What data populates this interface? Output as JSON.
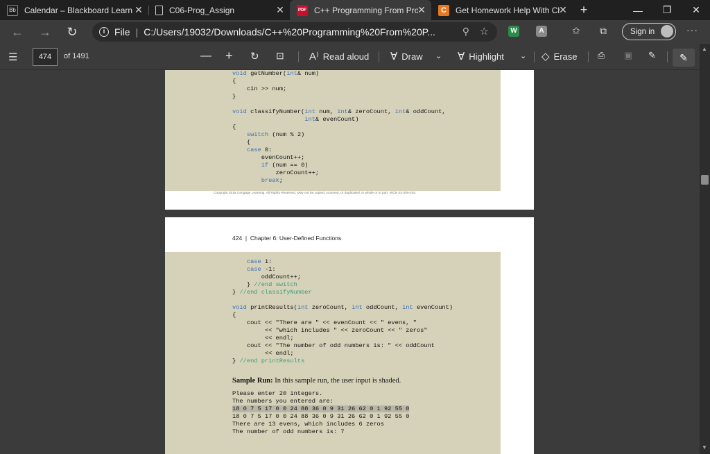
{
  "browser": {
    "tabs": [
      {
        "title": "Calendar – Blackboard Learn",
        "icon": "blackboard-icon",
        "active": false
      },
      {
        "title": "C06-Prog_Assign",
        "icon": "document-icon",
        "active": false
      },
      {
        "title": "C++ Programming From Probl",
        "icon": "pdf-icon",
        "active": true
      },
      {
        "title": "Get Homework Help With Che",
        "icon": "chegg-icon",
        "active": false
      }
    ],
    "new_tab": "+",
    "address": {
      "protocol_label": "File",
      "url": "C:/Users/19032/Downloads/C++%20Programming%20From%20P..."
    },
    "sign_in_label": "Sign in",
    "colors": {
      "chegg": "#e87722",
      "pdf": "#c8102e",
      "accent_green": "#2a8c4a"
    }
  },
  "pdf_toolbar": {
    "page_number": "474",
    "page_count": "of 1491",
    "read_aloud": "Read aloud",
    "draw": "Draw",
    "highlight": "Highlight",
    "erase": "Erase"
  },
  "page1": {
    "code_lines": [
      "void getNumber(int& num)",
      "{",
      "    cin >> num;",
      "}",
      "",
      "void classifyNumber(int num, int& zeroCount, int& oddCount,",
      "                    int& evenCount)",
      "{",
      "    switch (num % 2)",
      "    {",
      "    case 0:",
      "        evenCount++;",
      "        if (num == 0)",
      "            zeroCount++;",
      "        break;"
    ],
    "copyright": "Copyright 2018 Cengage Learning. All Rights Reserved. May not be copied, scanned, or duplicated, in whole or in part.  WCN 02-200-203"
  },
  "page2": {
    "page_number": "424",
    "chapter": "Chapter 6: User-Defined Functions",
    "code_lines": [
      "    case 1:",
      "    case -1:",
      "        oddCount++;",
      "    } //end switch",
      "} //end classifyNumber",
      "",
      "void printResults(int zeroCount, int oddCount, int evenCount)",
      "{",
      "    cout << \"There are \" << evenCount << \" evens, \"",
      "         << \"which includes \" << zeroCount << \" zeros\"",
      "         << endl;",
      "    cout << \"The number of odd numbers is: \" << oddCount",
      "         << endl;",
      "} //end printResults"
    ],
    "sample_label": "Sample Run:",
    "sample_text": " In this sample run, the user input is shaded.",
    "output_lines": [
      "Please enter 20 integers.",
      "The numbers you entered are:",
      "18 0 7 5 17 0 0 24 88 36 0 9 31 26 62 0 1 92 55 0",
      "18 0 7 5 17 0 0 24 88 36 0 9 31 26 62 0 1 92 55 0",
      "There are 13 evens, which includes 6 zeros",
      "The number of odd numbers is: 7"
    ]
  }
}
